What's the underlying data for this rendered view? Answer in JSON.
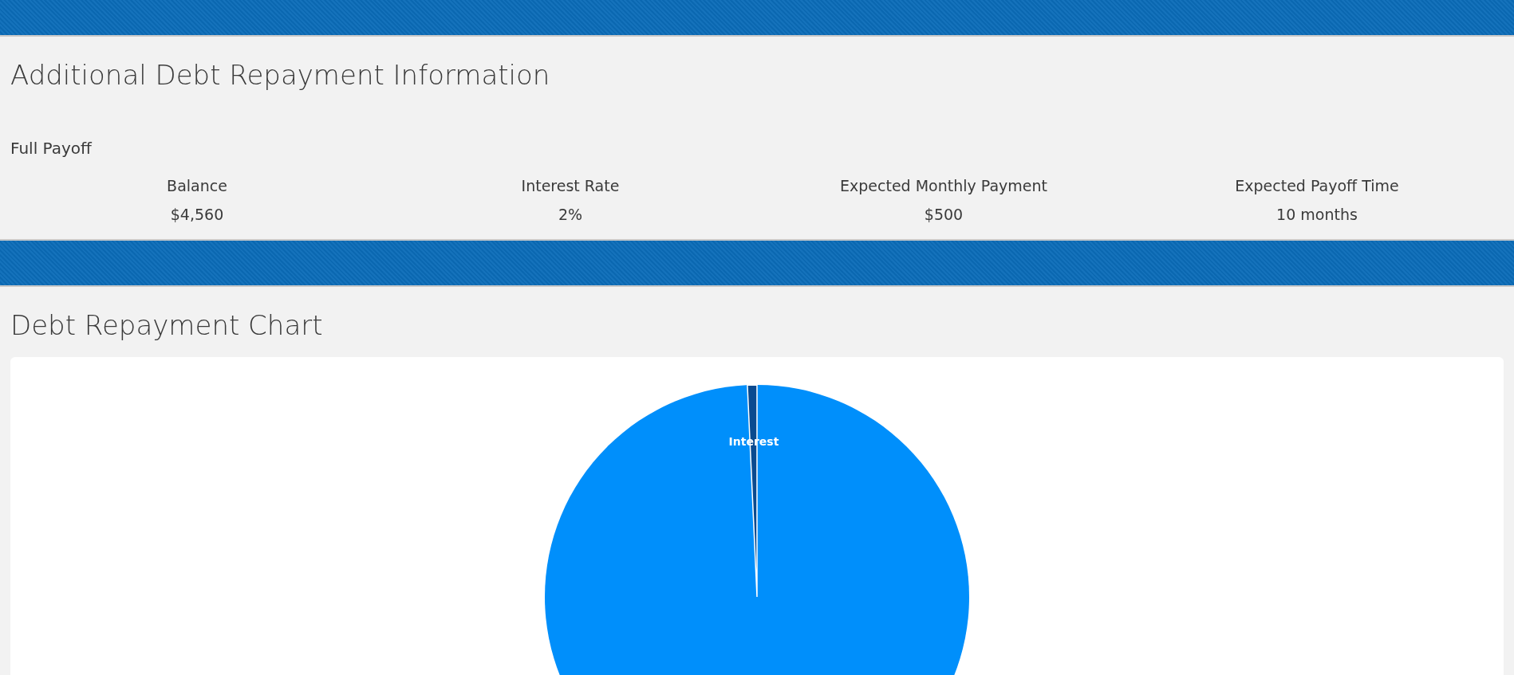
{
  "info_section": {
    "title": "Additional Debt Repayment Information",
    "plan": "Full Payoff",
    "stats": [
      {
        "label": "Balance",
        "value": "$4,560"
      },
      {
        "label": "Interest Rate",
        "value": "2%"
      },
      {
        "label": "Expected Monthly Payment",
        "value": "$500"
      },
      {
        "label": "Expected Payoff Time",
        "value": "10 months"
      }
    ]
  },
  "chart_section": {
    "title": "Debt Repayment Chart",
    "slice_label": "Interest"
  }
}
